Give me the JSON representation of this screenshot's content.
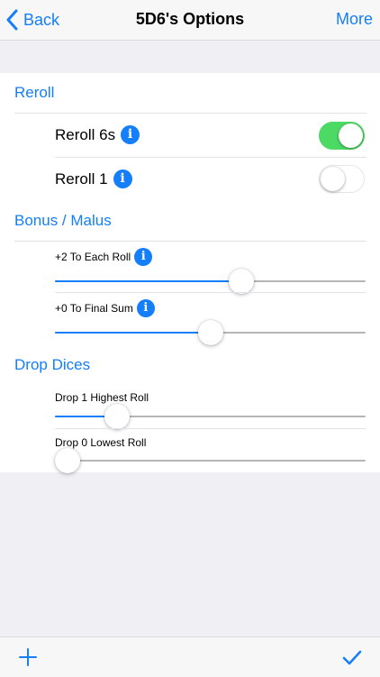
{
  "navbar": {
    "back_label": "Back",
    "title": "5D6's Options",
    "more_label": "More"
  },
  "accent_color": "#147efb",
  "toggle_on_color": "#4cd964",
  "sections": {
    "reroll": {
      "title": "Reroll",
      "rows": [
        {
          "label": "Reroll 6s",
          "enabled": true,
          "icon": "info-icon"
        },
        {
          "label": "Reroll 1",
          "enabled": false,
          "icon": "info-icon"
        }
      ]
    },
    "bonus": {
      "title": "Bonus / Malus",
      "rows": [
        {
          "label": "+2 To Each Roll",
          "level_percent": 60,
          "icon": "info-icon"
        },
        {
          "label": "+0 To Final Sum",
          "level_percent": 50,
          "icon": "info-icon"
        }
      ]
    },
    "drop": {
      "title": "Drop Dices",
      "rows": [
        {
          "label": "Drop 1 Highest Roll",
          "level_percent": 20
        },
        {
          "label": "Drop 0 Lowest Roll",
          "level_percent": 0
        }
      ]
    }
  },
  "toolbar": {
    "left_icon": "plus-icon",
    "right_icon": "checkmark-icon"
  }
}
